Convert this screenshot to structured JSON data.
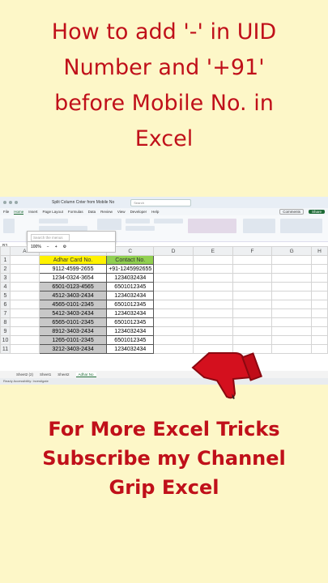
{
  "title_lines": [
    "How to add '-' in UID",
    "Number and '+91'",
    "before Mobile No. in",
    "Excel"
  ],
  "footer_lines": [
    "For More Excel Tricks",
    "Subscribe my Channel",
    "Grip Excel"
  ],
  "excel": {
    "file_name": "Split Column Cnter from Mobile No",
    "search_placeholder": "Search",
    "menu": [
      "File",
      "Home",
      "Insert",
      "Page Layout",
      "Formulas",
      "Data",
      "Review",
      "View",
      "Developer",
      "Help"
    ],
    "active_menu": "Home",
    "comments_label": "Comments",
    "share_label": "Share",
    "name_box": "B3",
    "formula_value": "1234032434",
    "mini_search_placeholder": "Search the menus",
    "zoom_label": "100%",
    "columns": [
      "A",
      "B",
      "C",
      "D",
      "E",
      "F",
      "G",
      "H"
    ],
    "header_row": {
      "b": "Adhar Card No.",
      "c": "Contact No."
    },
    "rows": [
      {
        "n": "2",
        "b": "9112-4599-2655",
        "c": "+91-1245992655"
      },
      {
        "n": "3",
        "b": "1234-0324-3654",
        "c": "1234032434"
      },
      {
        "n": "4",
        "b": "6501-0123-4565",
        "c": "6501012345"
      },
      {
        "n": "5",
        "b": "4512-3403-2434",
        "c": "1234032434"
      },
      {
        "n": "6",
        "b": "4565-0101-2345",
        "c": "6501012345"
      },
      {
        "n": "7",
        "b": "5412-3403-2434",
        "c": "1234032434"
      },
      {
        "n": "8",
        "b": "6565-0101-2345",
        "c": "6501012345"
      },
      {
        "n": "9",
        "b": "8912-3403-2434",
        "c": "1234032434"
      },
      {
        "n": "10",
        "b": "1265-0101-2345",
        "c": "6501012345"
      },
      {
        "n": "11",
        "b": "3212-3403-2434",
        "c": "1234032434"
      }
    ],
    "sheet_tabs": [
      "Sheet2 (2)",
      "Sheet1",
      "Sheet2",
      "Adhar No"
    ],
    "active_sheet": "Adhar No",
    "status_text": "Ready   Accessibility: Investigate"
  }
}
